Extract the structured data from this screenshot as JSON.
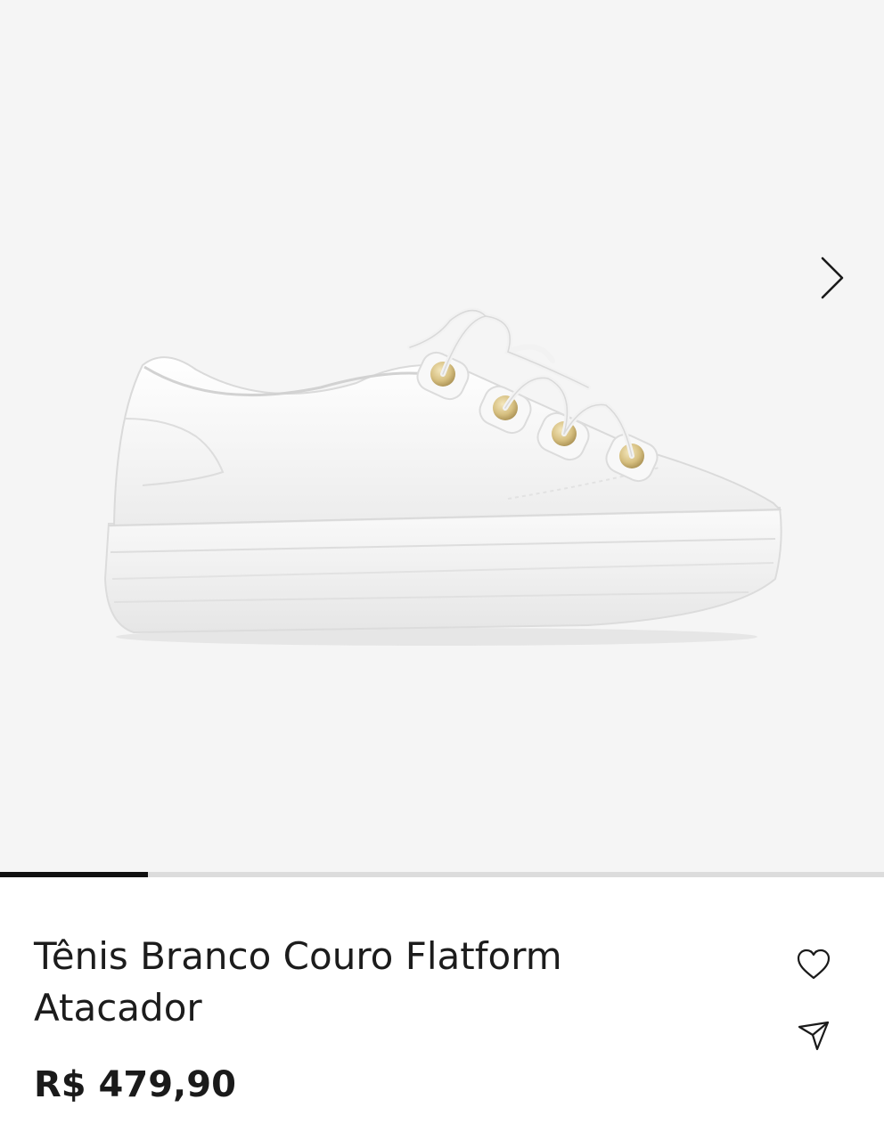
{
  "gallery": {
    "image_alt": "Tênis branco de couro com plataforma e cadarço com ilhoses dourados",
    "next_icon": "chevron-right-icon",
    "slide_progress": 0.167
  },
  "product": {
    "title": "Tênis Branco Couro Flatform Atacador",
    "price": "R$ 479,90"
  },
  "actions": {
    "favorite_icon": "heart-icon",
    "share_icon": "send-icon"
  },
  "colors": {
    "gallery_bg": "#f5f5f5",
    "progress_active": "#111111",
    "progress_track": "#dcdcdc",
    "eyelet_gold": "#d8c48a"
  }
}
